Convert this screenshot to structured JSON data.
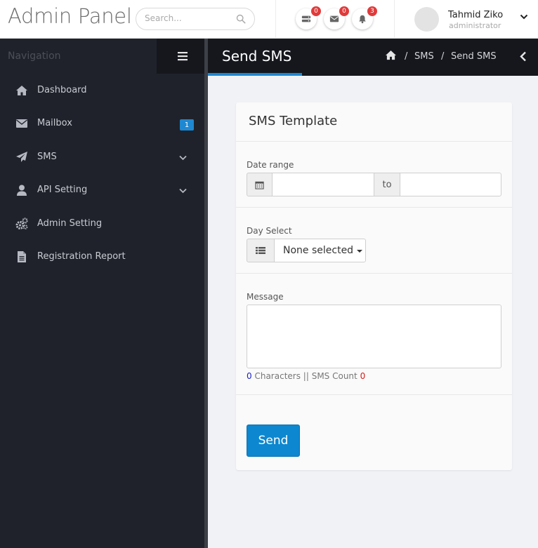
{
  "header": {
    "brand": "Admin Panel",
    "search_placeholder": "Search...",
    "notifications": [
      {
        "icon": "server-icon",
        "count": "0"
      },
      {
        "icon": "envelope-icon",
        "count": "0"
      },
      {
        "icon": "bell-icon",
        "count": "3"
      }
    ],
    "user": {
      "name": "Tahmid Ziko",
      "role": "administrator"
    }
  },
  "sidebar": {
    "title": "Navigation",
    "items": [
      {
        "label": "Dashboard",
        "icon": "home-icon"
      },
      {
        "label": "Mailbox",
        "icon": "envelope-icon",
        "badge": "1"
      },
      {
        "label": "SMS",
        "icon": "paper-plane-icon"
      },
      {
        "label": "API Setting",
        "icon": "user-icon"
      },
      {
        "label": "Admin Setting",
        "icon": "gears-icon"
      },
      {
        "label": "Registration Report",
        "icon": "file-icon"
      }
    ]
  },
  "titlebar": {
    "title": "Send SMS",
    "breadcrumb": [
      "SMS",
      "Send SMS"
    ],
    "separator": "/"
  },
  "form": {
    "card_title": "SMS Template",
    "date_range_label": "Date range",
    "date_to": "to",
    "date_from_value": "",
    "date_to_value": "",
    "day_select_label": "Day Select",
    "day_select_value": "None selected",
    "message_label": "Message",
    "message_value": "",
    "char_count": "0",
    "characters_text": "Characters ||",
    "sms_count_text": "SMS Count",
    "sms_count": "0",
    "send_label": "Send"
  },
  "colors": {
    "accent": "#1e88d2",
    "sidebar_bg": "#1f222b",
    "titlebar_bg": "#15171d",
    "badge_red": "#e03b3b",
    "send_button": "#0d87cf"
  }
}
